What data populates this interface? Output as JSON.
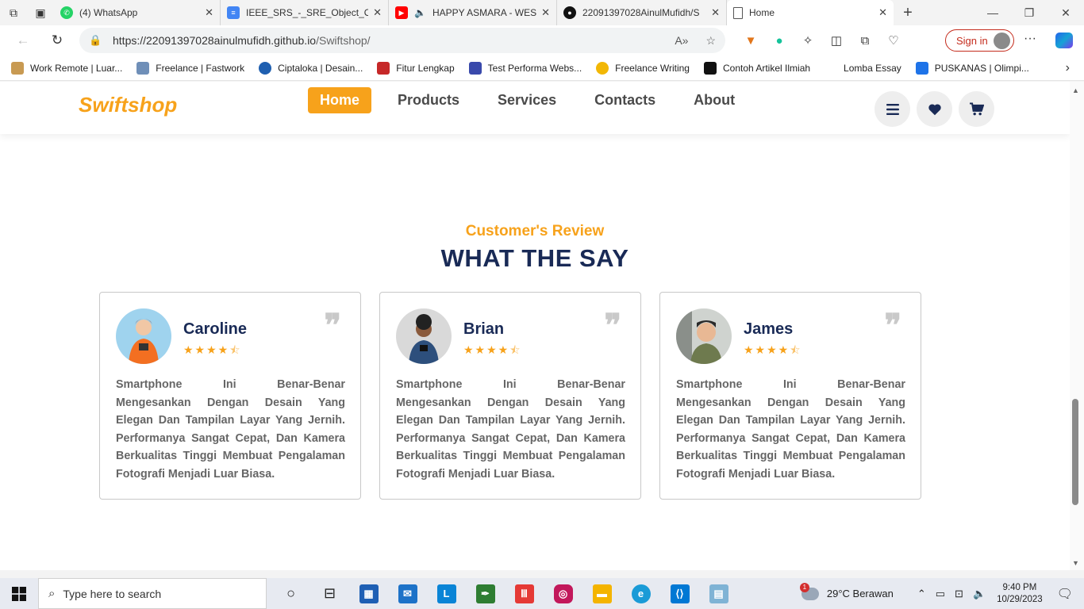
{
  "browser": {
    "tabs": [
      {
        "title": "(4) WhatsApp",
        "icon": "whatsapp-icon",
        "color": "#25d366"
      },
      {
        "title": "IEEE_SRS_-_SRE_Object_Orie",
        "icon": "docs-icon",
        "color": "#4285f4"
      },
      {
        "title": "HAPPY ASMARA - WES",
        "icon": "youtube-icon",
        "color": "#ff0000"
      },
      {
        "title": "22091397028AinulMufidh/S",
        "icon": "github-icon",
        "color": "#111111"
      },
      {
        "title": "Home",
        "icon": "page-icon",
        "color": "#ffffff"
      }
    ],
    "url_main": "https://22091397028ainulmufidh.github.io",
    "url_path": "/Swiftshop/",
    "sign_in": "Sign in",
    "bookmarks": [
      {
        "label": "Work Remote | Luar...",
        "color": "#c89a52"
      },
      {
        "label": "Freelance | Fastwork",
        "color": "#6f8fb8"
      },
      {
        "label": "Ciptaloka | Desain...",
        "color": "#1f5fb0"
      },
      {
        "label": "Fitur Lengkap",
        "color": "#c62828"
      },
      {
        "label": "Test Performa Webs...",
        "color": "#3949ab"
      },
      {
        "label": "Freelance Writing",
        "color": "#f2b705"
      },
      {
        "label": "Contoh Artikel Ilmiah",
        "color": "#111111"
      },
      {
        "label": "Lomba Essay",
        "color": "#ffffff"
      },
      {
        "label": "PUSKANAS | Olimpi...",
        "color": "#1e73e8"
      }
    ]
  },
  "site": {
    "logo": "Swiftshop",
    "nav": [
      "Home",
      "Products",
      "Services",
      "Contacts",
      "About"
    ],
    "accent": "#f7a21b",
    "navy": "#192a56"
  },
  "reviews": {
    "subtitle": "Customer's Review",
    "heading": "WHAT THE SAY",
    "items": [
      {
        "name": "Caroline",
        "rating": 4.5,
        "text": "Smartphone Ini Benar-Benar Mengesankan Dengan Desain Yang Elegan Dan Tampilan Layar Yang Jernih. Performanya Sangat Cepat, Dan Kamera Berkualitas Tinggi Membuat Pengalaman Fotografi Menjadi Luar Biasa."
      },
      {
        "name": "Brian",
        "rating": 4.5,
        "text": "Smartphone Ini Benar-Benar Mengesankan Dengan Desain Yang Elegan Dan Tampilan Layar Yang Jernih. Performanya Sangat Cepat, Dan Kamera Berkualitas Tinggi Membuat Pengalaman Fotografi Menjadi Luar Biasa."
      },
      {
        "name": "James",
        "rating": 4.5,
        "text": "Smartphone Ini Benar-Benar Mengesankan Dengan Desain Yang Elegan Dan Tampilan Layar Yang Jernih. Performanya Sangat Cepat, Dan Kamera Berkualitas Tinggi Membuat Pengalaman Fotografi Menjadi Luar Biasa."
      }
    ]
  },
  "taskbar": {
    "search_placeholder": "Type here to search",
    "weather": "29°C  Berawan",
    "time": "9:40 PM",
    "date": "10/29/2023",
    "weather_badge": "1"
  }
}
